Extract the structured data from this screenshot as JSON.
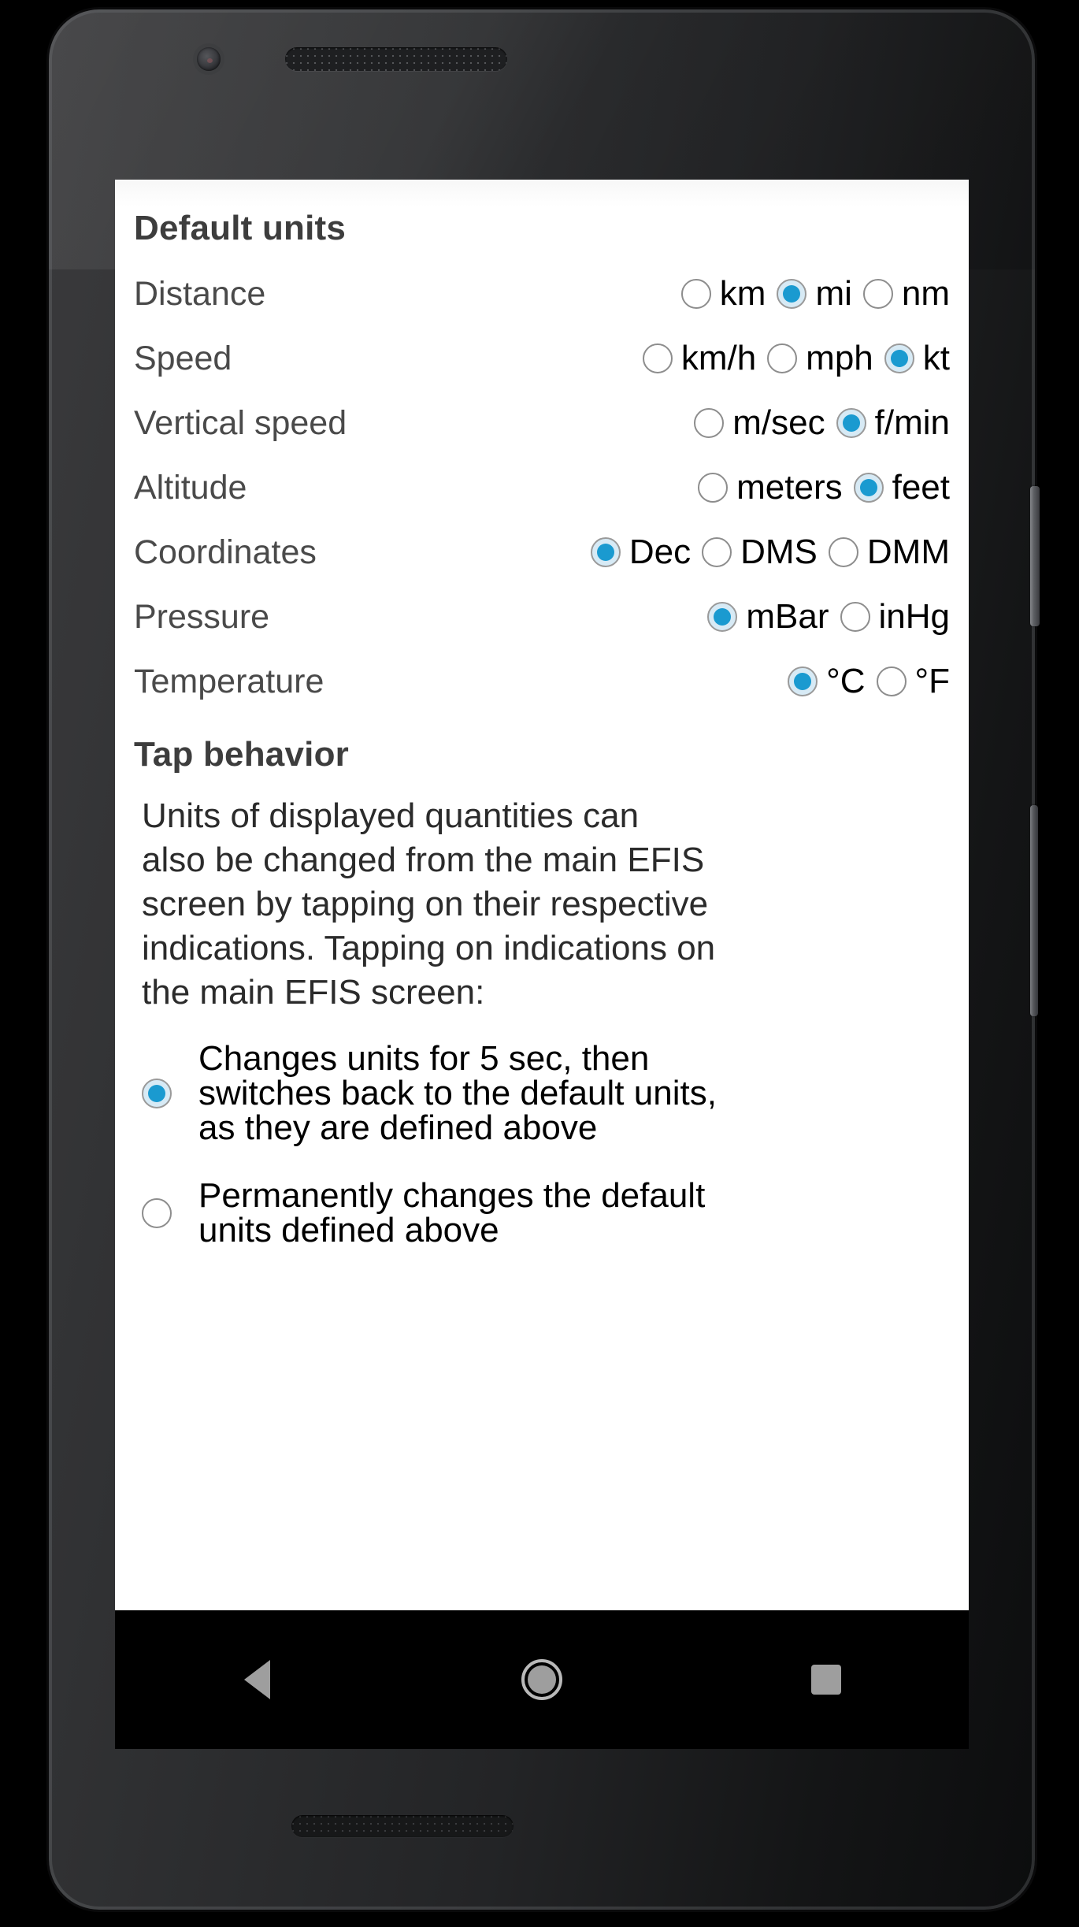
{
  "screen": {
    "sections": {
      "default_units": {
        "heading": "Default units",
        "rows": [
          {
            "label": "Distance",
            "options": [
              {
                "label": "km",
                "selected": false
              },
              {
                "label": "mi",
                "selected": true
              },
              {
                "label": "nm",
                "selected": false
              }
            ]
          },
          {
            "label": "Speed",
            "options": [
              {
                "label": "km/h",
                "selected": false
              },
              {
                "label": "mph",
                "selected": false
              },
              {
                "label": "kt",
                "selected": true
              }
            ]
          },
          {
            "label": "Vertical speed",
            "options": [
              {
                "label": "m/sec",
                "selected": false
              },
              {
                "label": "f/min",
                "selected": true
              }
            ]
          },
          {
            "label": "Altitude",
            "options": [
              {
                "label": "meters",
                "selected": false
              },
              {
                "label": "feet",
                "selected": true
              }
            ]
          },
          {
            "label": "Coordinates",
            "options": [
              {
                "label": "Dec",
                "selected": true
              },
              {
                "label": "DMS",
                "selected": false
              },
              {
                "label": "DMM",
                "selected": false
              }
            ]
          },
          {
            "label": "Pressure",
            "options": [
              {
                "label": "mBar",
                "selected": true
              },
              {
                "label": "inHg",
                "selected": false
              }
            ]
          },
          {
            "label": "Temperature",
            "options": [
              {
                "label": "°C",
                "selected": true
              },
              {
                "label": "°F",
                "selected": false
              }
            ]
          }
        ]
      },
      "tap_behavior": {
        "heading": "Tap behavior",
        "paragraph_lines": [
          "Units of displayed quantities can",
          "also be changed from the main EFIS",
          "screen by tapping on their respective",
          "indications. Tapping on indications on",
          "the main EFIS screen:"
        ],
        "choices": [
          {
            "selected": true,
            "lines": [
              "Changes units for 5 sec, then",
              "switches back to the default units,",
              "as they are defined above"
            ]
          },
          {
            "selected": false,
            "lines": [
              "Permanently changes the default",
              "units defined above"
            ]
          }
        ]
      }
    }
  },
  "nav_bar": {
    "back": "back-icon",
    "home": "home-icon",
    "recents": "recents-icon"
  },
  "device": {
    "front_camera": "camera-icon",
    "earpiece": "speaker-grille-icon",
    "bottom_speaker": "speaker-grille-icon",
    "power_button": "power-button",
    "volume_rocker": "volume-rocker"
  },
  "colors": {
    "accent_blue": "#1a9ad0",
    "accent_halo": "#d7eaf5",
    "heading": "#3d3d3d",
    "row_label": "#4a4a4a",
    "option_label": "#000000",
    "nav_icon": "#9e9e9e",
    "screen_bg": "#ffffff",
    "nav_bg": "#000000"
  }
}
